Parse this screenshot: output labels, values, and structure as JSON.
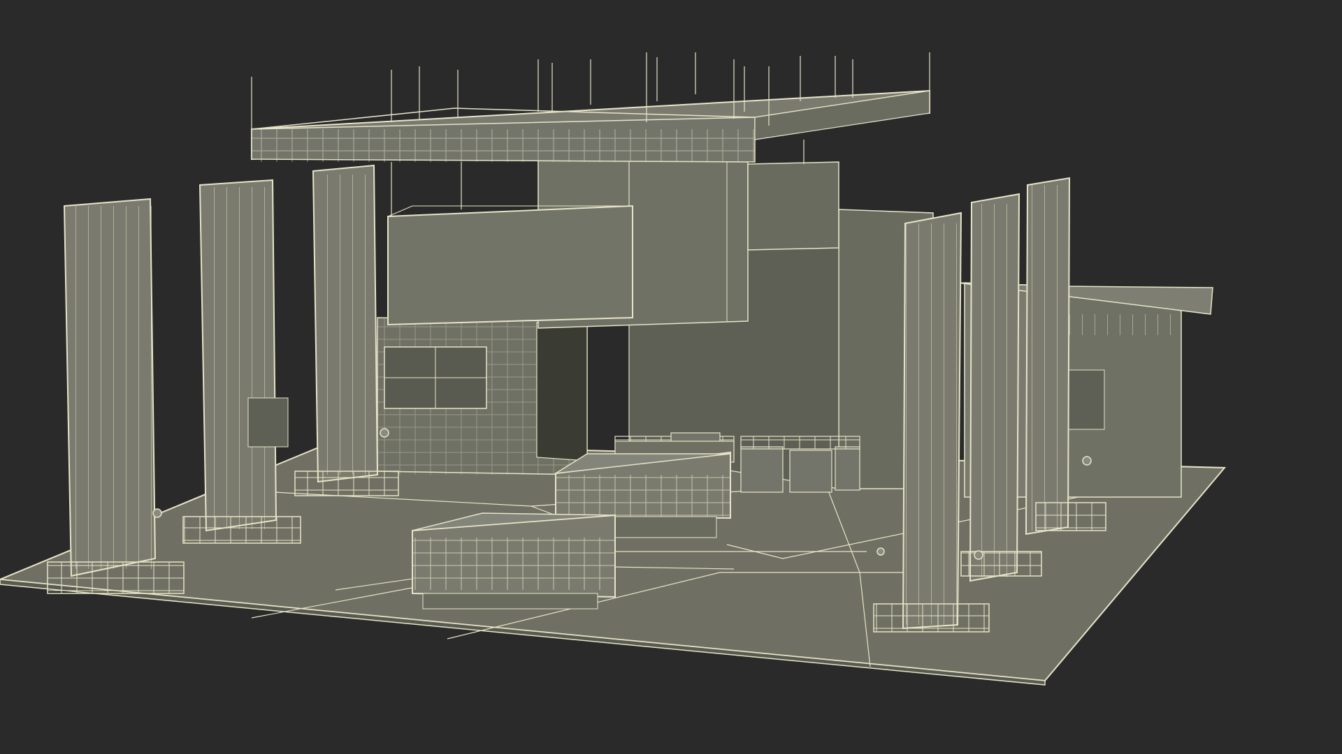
{
  "scene": {
    "subject": "exhibition-stand-wireframe",
    "colors": {
      "background": "#2a2a2a",
      "surface": "#76776a",
      "surface_dark": "#5f6055",
      "surface_light": "#8a8b7e",
      "wire": "#e6e4c8"
    }
  }
}
